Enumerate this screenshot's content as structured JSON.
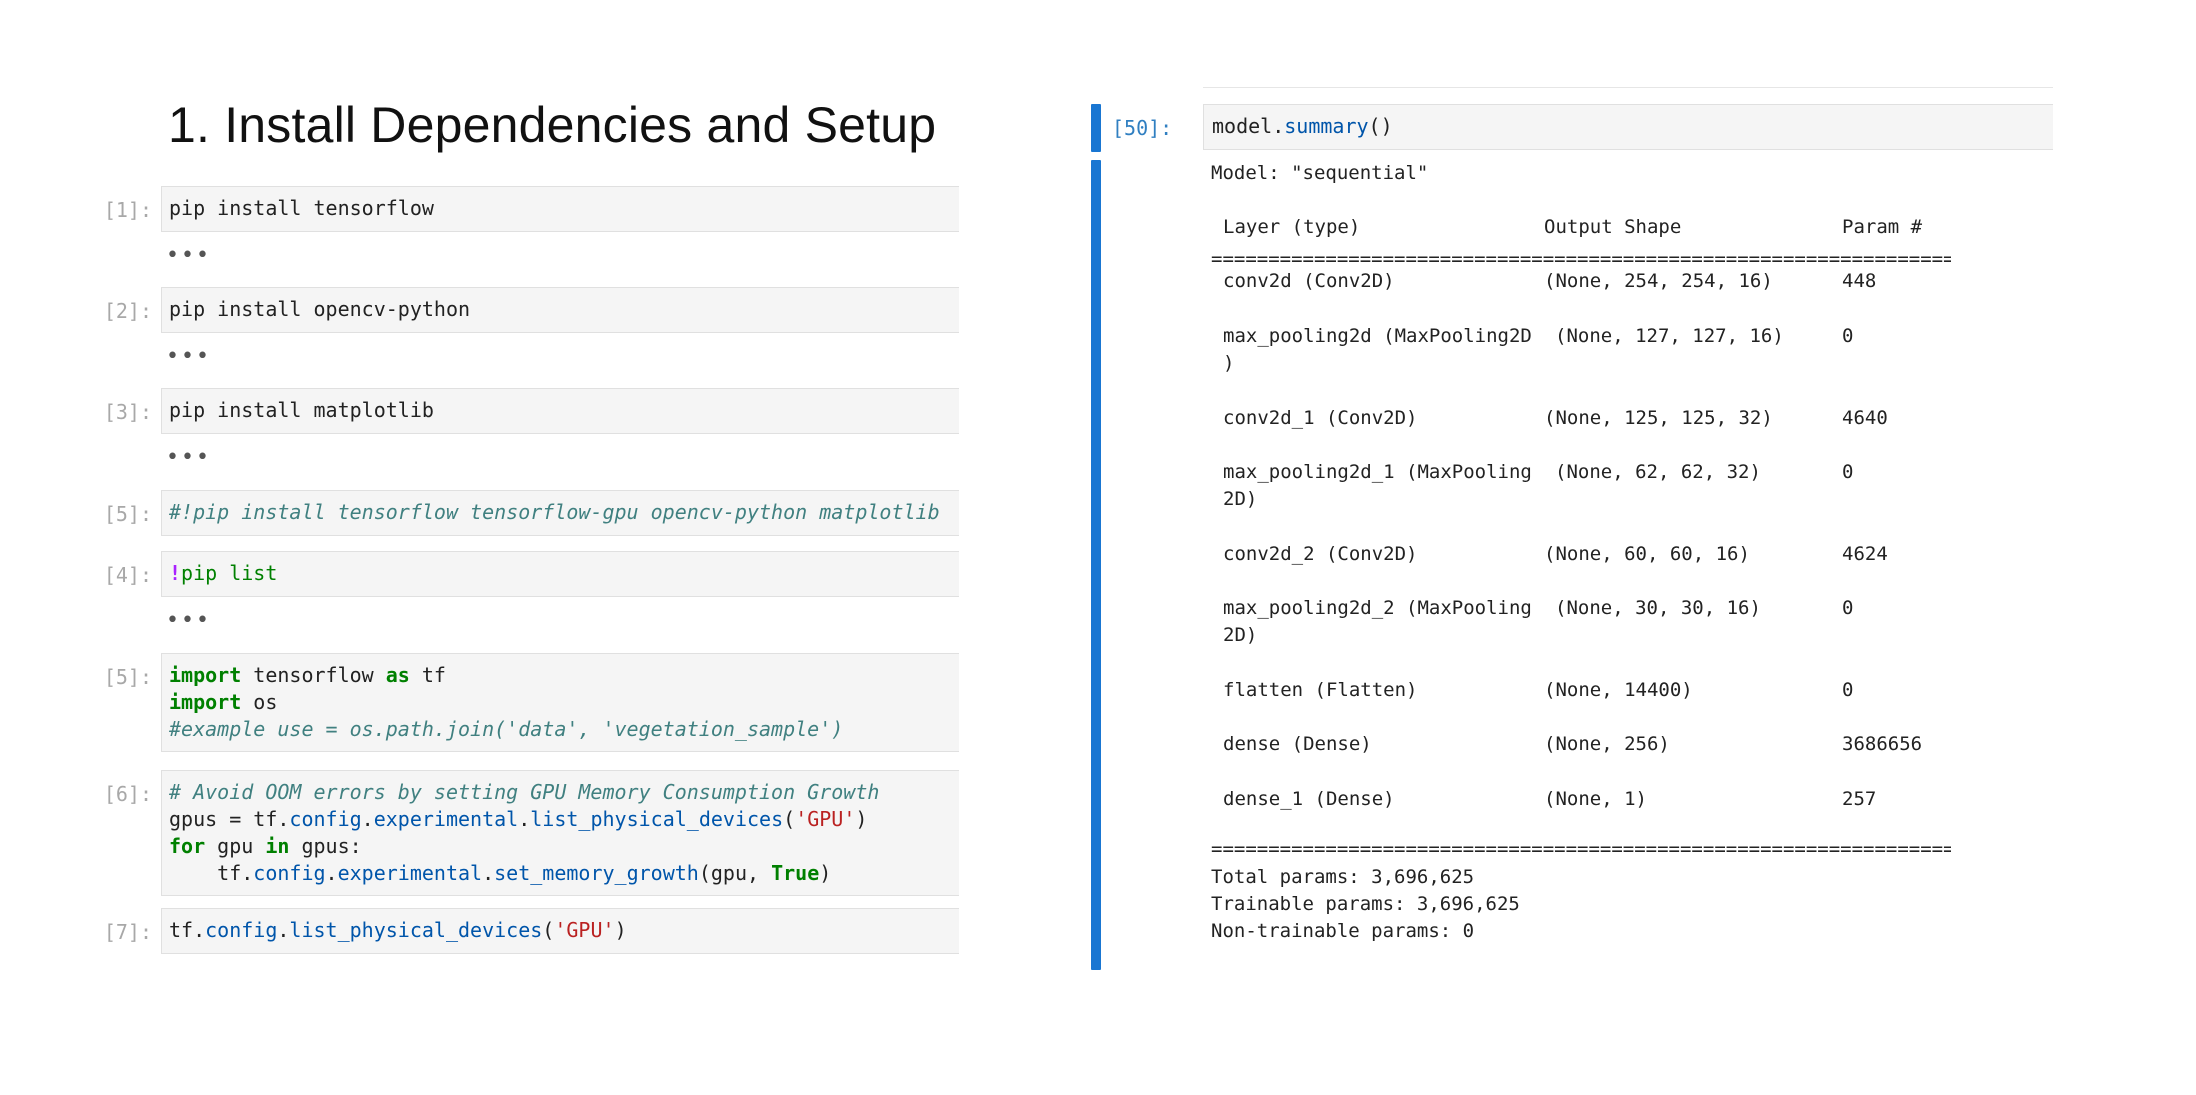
{
  "left": {
    "heading": "1. Install Dependencies and Setup",
    "ellipsis": "•••",
    "cells": [
      {
        "prompt": "[1]:",
        "code": "pip install tensorflow"
      },
      {
        "prompt": "[2]:",
        "code": "pip install opencv-python"
      },
      {
        "prompt": "[3]:",
        "code": "pip install matplotlib"
      },
      {
        "prompt": "[5]:",
        "code": "#!pip install tensorflow tensorflow-gpu opencv-python matplotlib"
      },
      {
        "prompt": "[4]:",
        "code_prefix": "!",
        "code": "pip list"
      },
      {
        "prompt": "[5]:",
        "line1": {
          "k1": "import",
          "t1": " tensorflow ",
          "k2": "as",
          "t2": " tf"
        },
        "line2": {
          "k1": "import",
          "t1": " os"
        },
        "line3": "#example use = os.path.join('data', 'vegetation_sample')"
      },
      {
        "prompt": "[6]:",
        "line1": "# Avoid OOM errors by setting GPU Memory Consumption Growth",
        "line2": {
          "a": "gpus = tf.",
          "b": "config",
          "c": ".",
          "d": "experimental",
          "e": ".",
          "f": "list_physical_devices",
          "g": "(",
          "h": "'GPU'",
          "i": ")"
        },
        "line3": {
          "k1": "for",
          "t1": " gpu ",
          "k2": "in",
          "t2": " gpus:"
        },
        "line4": {
          "a": "    tf.",
          "b": "config",
          "c": ".",
          "d": "experimental",
          "e": ".",
          "f": "set_memory_growth",
          "g": "(gpu, ",
          "h": "True",
          "i": ")"
        }
      },
      {
        "prompt": "[7]:",
        "line1": {
          "a": "tf.",
          "b": "config",
          "c": ".",
          "d": "list_physical_devices",
          "e": "(",
          "f": "'GPU'",
          "g": ")"
        }
      }
    ]
  },
  "right": {
    "prompt": "[50]:",
    "input": {
      "a": "model.",
      "b": "summary",
      "c": "()"
    },
    "model_line": "Model: \"sequential\"",
    "rule_single": "_________________________________________________________________",
    "rule_double": "=================================================================",
    "headers": {
      "layer": "Layer (type)",
      "shape": "Output Shape",
      "params": "Param #"
    },
    "rows": [
      {
        "layer": "conv2d (Conv2D)",
        "layer2": "",
        "shape": "(None, 254, 254, 16)",
        "params": "448"
      },
      {
        "layer": "max_pooling2d (MaxPooling2D",
        "layer2": ")",
        "shape": "(None, 127, 127, 16)",
        "params": "0"
      },
      {
        "layer": "conv2d_1 (Conv2D)",
        "layer2": "",
        "shape": "(None, 125, 125, 32)",
        "params": "4640"
      },
      {
        "layer": "max_pooling2d_1 (MaxPooling",
        "layer2": "2D)",
        "shape": "(None, 62, 62, 32)",
        "params": "0"
      },
      {
        "layer": "conv2d_2 (Conv2D)",
        "layer2": "",
        "shape": "(None, 60, 60, 16)",
        "params": "4624"
      },
      {
        "layer": "max_pooling2d_2 (MaxPooling",
        "layer2": "2D)",
        "shape": "(None, 30, 30, 16)",
        "params": "0"
      },
      {
        "layer": "flatten (Flatten)",
        "layer2": "",
        "shape": "(None, 14400)",
        "params": "0"
      },
      {
        "layer": "dense (Dense)",
        "layer2": "",
        "shape": "(None, 256)",
        "params": "3686656"
      },
      {
        "layer": "dense_1 (Dense)",
        "layer2": "",
        "shape": "(None, 1)",
        "params": "257"
      }
    ],
    "totals": {
      "total": "Total params: 3,696,625",
      "trainable": "Trainable params: 3,696,625",
      "non_trainable": "Non-trainable params: 0"
    }
  }
}
